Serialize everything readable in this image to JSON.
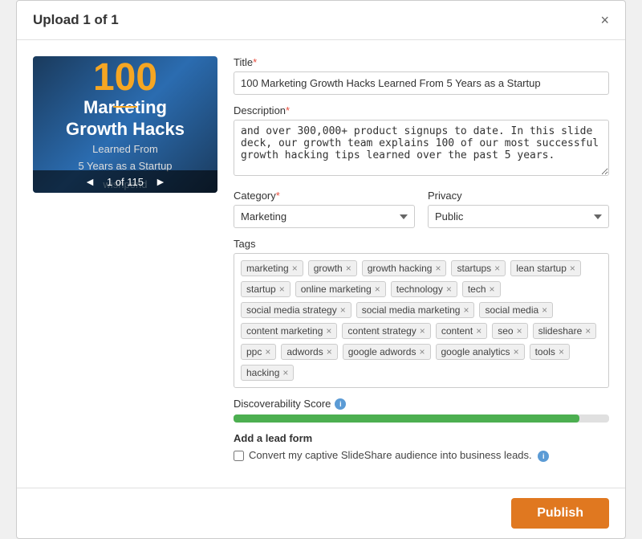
{
  "modal": {
    "title": "Upload 1 of 1",
    "close_label": "×"
  },
  "slide": {
    "big_number": "100",
    "line1": "Marketing",
    "line2": "Growth Hacks",
    "subtitle1": "Learned From",
    "subtitle2": "5 Years as a Startup",
    "brand": "wishpond",
    "counter": "1 of 115"
  },
  "form": {
    "title_label": "Title",
    "title_value": "100 Marketing Growth Hacks Learned From 5 Years as a Startup",
    "description_label": "Description",
    "description_value": "and over 300,000+ product signups to date. In this slide deck, our growth team explains 100 of our most successful growth hacking tips learned over the past 5 years.",
    "category_label": "Category",
    "category_value": "Marketing",
    "privacy_label": "Privacy",
    "privacy_value": "Public",
    "tags_label": "Tags",
    "tags": [
      "marketing",
      "growth",
      "growth hacking",
      "startups",
      "lean startup",
      "startup",
      "online marketing",
      "technology",
      "tech",
      "social media strategy",
      "social media marketing",
      "social media",
      "content marketing",
      "content strategy",
      "content",
      "seo",
      "slideshare",
      "ppc",
      "adwords",
      "google adwords",
      "google analytics",
      "tools",
      "hacking"
    ],
    "discoverability_label": "Discoverability Score",
    "discoverability_percent": 92,
    "lead_form_label": "Add a lead form",
    "lead_form_checkbox_label": "Convert my captive SlideShare audience into business leads."
  },
  "footer": {
    "publish_label": "Publish"
  },
  "icons": {
    "info": "i",
    "close": "×",
    "tag_remove": "×",
    "prev_nav": "◄",
    "next_nav": "►"
  }
}
